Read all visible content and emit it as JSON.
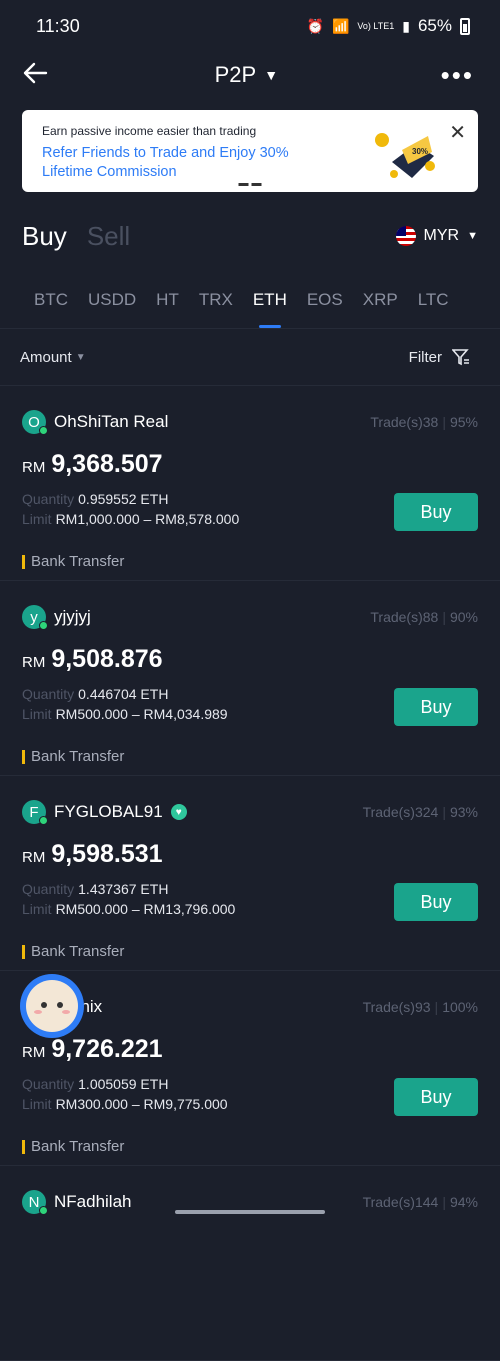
{
  "status": {
    "time": "11:30",
    "battery": "65%",
    "signal_text": "Vo) LTE1"
  },
  "header": {
    "title": "P2P"
  },
  "banner": {
    "small": "Earn passive income easier than trading",
    "big": "Refer Friends to Trade and Enjoy 30% Lifetime Commission",
    "badge": "30%"
  },
  "tabs": {
    "buy": "Buy",
    "sell": "Sell"
  },
  "currency": {
    "code": "MYR"
  },
  "coins": [
    "BTC",
    "USDD",
    "HT",
    "TRX",
    "ETH",
    "EOS",
    "XRP",
    "LTC"
  ],
  "coins_active": "ETH",
  "filter": {
    "amount": "Amount",
    "filter": "Filter"
  },
  "labels": {
    "quantity": "Quantity",
    "limit": "Limit",
    "buy": "Buy",
    "currency": "RM"
  },
  "offers": [
    {
      "initial": "O",
      "name": "OhShiTan Real",
      "trades": "Trade(s)38",
      "rate": "95%",
      "price": "9,368.507",
      "quantity": "0.959552 ETH",
      "limit": "RM1,000.000 – RM8,578.000",
      "payment": "Bank Transfer",
      "verified": false
    },
    {
      "initial": "y",
      "name": "yjyjyj",
      "trades": "Trade(s)88",
      "rate": "90%",
      "price": "9,508.876",
      "quantity": "0.446704 ETH",
      "limit": "RM500.000 – RM4,034.989",
      "payment": "Bank Transfer",
      "verified": false
    },
    {
      "initial": "F",
      "name": "FYGLOBAL91",
      "trades": "Trade(s)324",
      "rate": "93%",
      "price": "9,598.531",
      "quantity": "1.437367 ETH",
      "limit": "RM500.000 – RM13,796.000",
      "payment": "Bank Transfer",
      "verified": true
    },
    {
      "initial": "",
      "name": "yashix",
      "trades": "Trade(s)93",
      "rate": "100%",
      "price": "9,726.221",
      "quantity": "1.005059 ETH",
      "limit": "RM300.000 – RM9,775.000",
      "payment": "Bank Transfer",
      "verified": false
    },
    {
      "initial": "N",
      "name": "NFadhilah",
      "trades": "Trade(s)144",
      "rate": "94%",
      "price": "",
      "quantity": "",
      "limit": "",
      "payment": "",
      "verified": false
    }
  ]
}
